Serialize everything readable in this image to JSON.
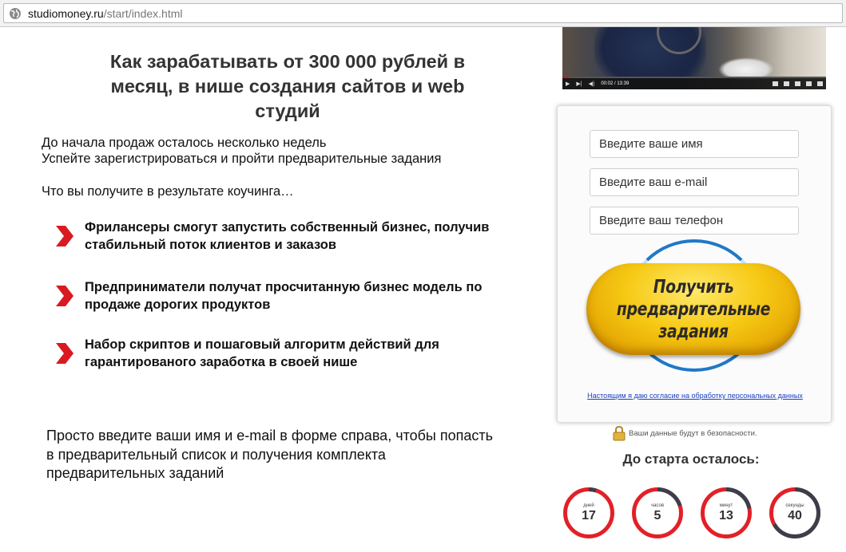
{
  "browser": {
    "url_domain": "studiomoney.ru",
    "url_path": "/start/index.html"
  },
  "headline": "Как зарабатывать от 300 000 рублей в месяц, в нише создания сайтов и web студий",
  "intro_line1": "До начала продаж осталось несколько недель",
  "intro_line2": "Успейте зарегистрироваться и пройти предварительные задания",
  "intro_question": "Что вы получите в результате коучинга…",
  "benefits": [
    "Фрилансеры смогут запустить собственный бизнес, получив стабильный поток клиентов и заказов",
    "Предприниматели получат просчитанную бизнес модель по продаже дорогих продуктов",
    "Набор скриптов и пошаговый алгоритм действий для гарантированого заработка в своей нише"
  ],
  "bottom_text": "Просто введите ваши имя и e-mail в форме справа, чтобы попасть в предварительный список и получения комплекта предварительных заданий",
  "video": {
    "time": "00:02 / 13:39"
  },
  "form": {
    "name_placeholder": "Введите ваше имя",
    "email_placeholder": "Введите ваш e-mail",
    "phone_placeholder": "Введите ваш телефон",
    "cta_label": "Получить предварительные задания",
    "consent": "Настоящим я даю согласие на обработку персональных данных"
  },
  "secure_note": "Ваши данные будут в безопасности.",
  "countdown": {
    "title": "До старта осталось:",
    "items": [
      {
        "unit": "дней",
        "value": "17",
        "fraction": 0.05
      },
      {
        "unit": "часов",
        "value": "5",
        "fraction": 0.2
      },
      {
        "unit": "минут",
        "value": "13",
        "fraction": 0.22
      },
      {
        "unit": "секунды",
        "value": "40",
        "fraction": 0.67
      }
    ]
  },
  "colors": {
    "ring_track": "#e32027",
    "ring_fill": "#3a3f4a",
    "chevron": "#d91a21",
    "consent_link": "#1b3fbf"
  }
}
